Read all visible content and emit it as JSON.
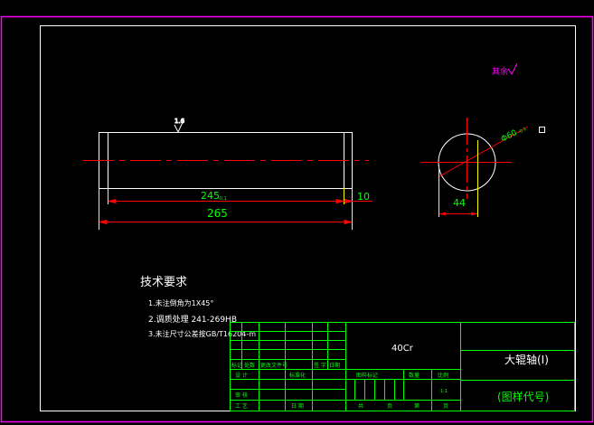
{
  "colors": {
    "background": "#000000",
    "outer_frame": "#ff00ff",
    "border": "#ffffff",
    "part": "#ffffff",
    "center_line": "#ff0000",
    "dimension": "#ff0000",
    "dim_text": "#00ff00",
    "extension": "#ffff00",
    "title_block": "#00ff00",
    "notes": "#ffffff"
  },
  "roughness": {
    "top_value": "1.6",
    "corner_label": "其余"
  },
  "dimensions": {
    "inner_length": "245",
    "inner_tolerance": "-0.1",
    "total_length": "265",
    "end_length": "10",
    "diameter": "Φ60",
    "diameter_tolerance": "-0.1",
    "key_width": "44"
  },
  "tech_requirements": {
    "title": "技术要求",
    "items": [
      "1.未注倒角为1X45°",
      "2.调质处理 241-269HB",
      "3.未注尺寸公差按GB/T16204-m"
    ]
  },
  "title_block": {
    "material": "40Cr",
    "part_name": "大辊轴(Ⅰ)",
    "drawing_number": "(图样代号)",
    "scale": "1:1",
    "rev_headers": [
      "标记",
      "处数",
      "更改文件号",
      "签 字",
      "日期"
    ],
    "design_row": [
      "设 计",
      "标准化"
    ],
    "check_row": [
      "审 核",
      ""
    ],
    "process_row": [
      "工 艺",
      "日 期"
    ],
    "stage_headers": [
      "图样标记",
      "数量",
      "比例"
    ],
    "sheet_labels": [
      "共",
      "页",
      "第",
      "页"
    ]
  }
}
